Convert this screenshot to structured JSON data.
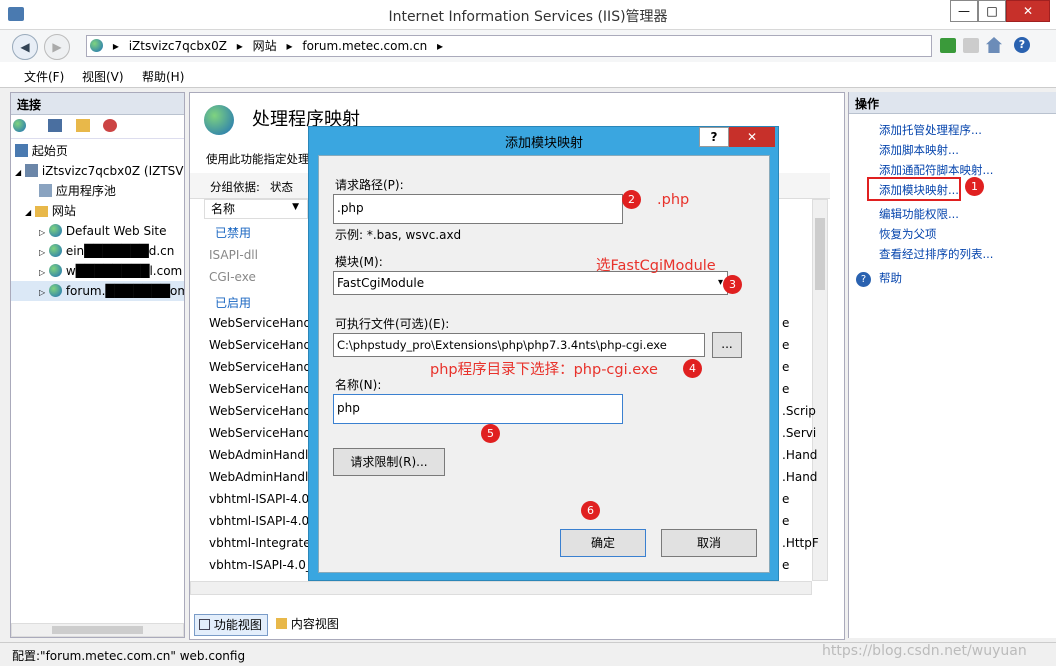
{
  "window": {
    "title": "Internet Information Services (IIS)管理器",
    "minimize": "—",
    "maximize": "□",
    "close": "✕"
  },
  "address": {
    "crumbs": [
      "iZtsvizc7qcbx0Z",
      "网站",
      "forum.metec.com.cn"
    ],
    "sep": "▸"
  },
  "menu": {
    "file": "文件(F)",
    "view": "视图(V)",
    "help": "帮助(H)"
  },
  "left": {
    "title": "连接",
    "tree": [
      "起始页",
      "iZtsvizc7qcbx0Z (IZTSVIZC",
      "应用程序池",
      "网站",
      "Default Web Site",
      "ein███████d.cn",
      "w████████l.com",
      "forum.███████om.c"
    ]
  },
  "center": {
    "title": "处理程序映射",
    "desc": "使用此功能指定处理",
    "group_label": "分组依据:",
    "group_value": "状态",
    "col_name": "名称",
    "disabled_group": "已禁用",
    "disabled_items": [
      "ISAPI-dll",
      "CGI-exe"
    ],
    "enabled_group": "已启用",
    "rows": [
      "WebServiceHand",
      "WebServiceHand",
      "WebServiceHand",
      "WebServiceHand",
      "WebServiceHand",
      "WebServiceHand",
      "WebAdminHandl",
      "WebAdminHandl",
      "vbhtml-ISAPI-4.0_",
      "vbhtml-ISAPI-4.0_",
      "vbhtml-Integrated",
      "vbhtm-ISAPI-4.0_"
    ],
    "right_frag": [
      "e",
      "e",
      "e",
      "e",
      ".Scrip",
      ".Servi",
      ".Hand",
      ".Hand",
      "e",
      "e",
      ".HttpF",
      "e"
    ]
  },
  "tabs": {
    "features": "功能视图",
    "content": "内容视图"
  },
  "right": {
    "title": "操作",
    "actions": [
      "添加托管处理程序...",
      "添加脚本映射...",
      "添加通配符脚本映射...",
      "添加模块映射...",
      "编辑功能权限...",
      "恢复为父项",
      "查看经过排序的列表...",
      "帮助"
    ]
  },
  "status": {
    "text": "配置:\"forum.metec.com.cn\" web.config",
    "watermark": "https://blog.csdn.net/wuyuan"
  },
  "dialog": {
    "title": "添加模块映射",
    "help": "?",
    "close": "✕",
    "path_label": "请求路径(P):",
    "path_value": ".php",
    "example": "示例: *.bas, wsvc.axd",
    "module_label": "模块(M):",
    "module_value": "FastCgiModule",
    "exe_label": "可执行文件(可选)(E):",
    "exe_value": "C:\\phpstudy_pro\\Extensions\\php\\php7.3.4nts\\php-cgi.exe",
    "browse": "...",
    "name_label": "名称(N):",
    "name_value": "php",
    "restrict": "请求限制(R)...",
    "ok": "确定",
    "cancel": "取消"
  },
  "annotations": {
    "n1": "1",
    "n2": "2",
    "n3": "3",
    "n4": "4",
    "n5": "5",
    "n6": "6",
    "a2": ".php",
    "a3": "选FastCgiModule",
    "a4": "php程序目录下选择：php-cgi.exe"
  },
  "colors": {
    "dialog_frame": "#3aa6e0",
    "close_red": "#c7302a",
    "annotation": "#e8322b",
    "link": "#0645ad"
  }
}
